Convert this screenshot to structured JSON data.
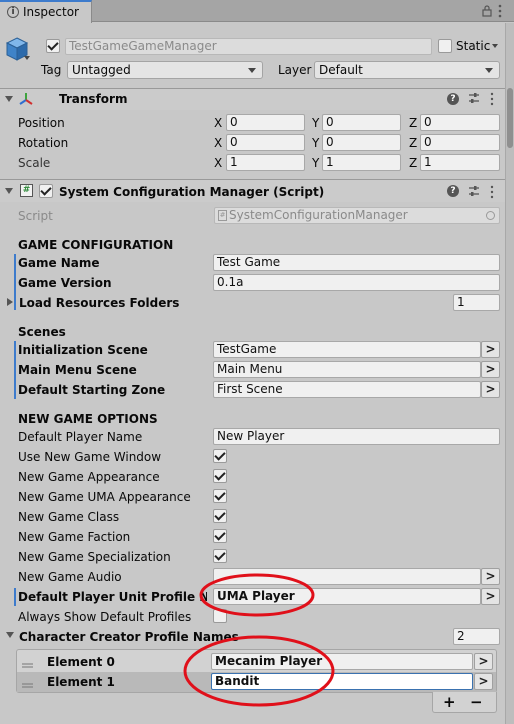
{
  "tab": {
    "title": "Inspector"
  },
  "object": {
    "name": "TestGameGameManager",
    "static_label": "Static",
    "tag_label": "Tag",
    "tag_value": "Untagged",
    "layer_label": "Layer",
    "layer_value": "Default"
  },
  "transform": {
    "title": "Transform",
    "rows": [
      {
        "label": "Position",
        "x": "0",
        "y": "0",
        "z": "0"
      },
      {
        "label": "Rotation",
        "x": "0",
        "y": "0",
        "z": "0"
      },
      {
        "label": "Scale",
        "x": "1",
        "y": "1",
        "z": "1"
      }
    ],
    "axis_x": "X",
    "axis_y": "Y",
    "axis_z": "Z"
  },
  "script_component": {
    "title": "System Configuration Manager (Script)",
    "script_label": "Script",
    "script_value": "SystemConfigurationManager",
    "game_config_header": "GAME CONFIGURATION",
    "game_name_label": "Game Name",
    "game_name_value": "Test Game",
    "game_version_label": "Game Version",
    "game_version_value": "0.1a",
    "load_resources_label": "Load Resources Folders",
    "load_resources_value": "1",
    "scenes_header": "Scenes",
    "init_scene_label": "Initialization Scene",
    "init_scene_value": "TestGame",
    "main_menu_label": "Main Menu Scene",
    "main_menu_value": "Main Menu",
    "default_zone_label": "Default Starting Zone",
    "default_zone_value": "First Scene",
    "new_game_header": "NEW GAME OPTIONS",
    "default_player_name_label": "Default Player Name",
    "default_player_name_value": "New Player",
    "toggles": [
      {
        "label": "Use New Game Window",
        "checked": true
      },
      {
        "label": "New Game Appearance",
        "checked": true
      },
      {
        "label": "New Game UMA Appearance",
        "checked": true
      },
      {
        "label": "New Game Class",
        "checked": true
      },
      {
        "label": "New Game Faction",
        "checked": true
      },
      {
        "label": "New Game Specialization",
        "checked": true
      }
    ],
    "new_game_audio_label": "New Game Audio",
    "new_game_audio_value": "",
    "default_profile_label": "Default Player Unit Profile Name",
    "default_profile_value": "UMA Player",
    "always_show_label": "Always Show Default Profiles",
    "creator_profiles_label": "Character Creator Profile Names",
    "creator_profiles_count": "2",
    "elements": [
      {
        "label": "Element 0",
        "value": "Mecanim Player"
      },
      {
        "label": "Element 1",
        "value": "Bandit"
      }
    ],
    "picker_glyph": ">",
    "add_glyph": "+",
    "remove_glyph": "−"
  },
  "colors": {
    "accent_blue": "#3d7bcc",
    "annotation_red": "#e0101a",
    "panel_bg": "#c8c8c8"
  }
}
